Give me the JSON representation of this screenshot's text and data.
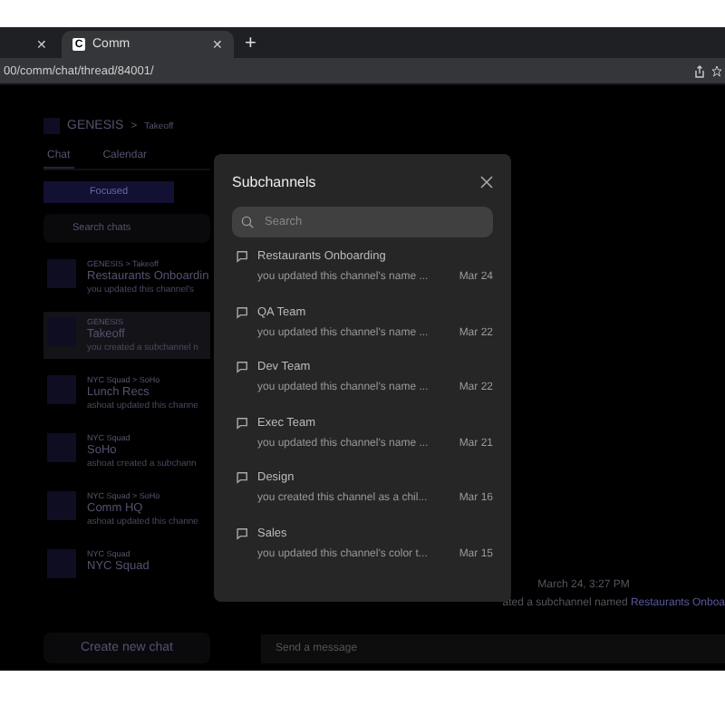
{
  "browser": {
    "tabs": [
      {
        "close": "✕",
        "selected": false
      },
      {
        "title": "Comm",
        "favicon": "C",
        "close": "✕",
        "selected": true
      }
    ],
    "new_tab": "+",
    "url": "00/comm/chat/thread/84001/"
  },
  "header": {
    "community": "GENESIS",
    "separator": ">",
    "channel": "Takeoff"
  },
  "sidebar": {
    "tabs": [
      {
        "label": "Chat",
        "selected": true
      },
      {
        "label": "Calendar",
        "selected": false
      }
    ],
    "filter": "Focused",
    "search_placeholder": "Search chats",
    "chats": [
      {
        "path": "GENESIS > Takeoff",
        "name": "Restaurants Onboardin",
        "preview": "you updated this channel's",
        "selected": false
      },
      {
        "path": "GENESIS",
        "name": "Takeoff",
        "preview": "you created a subchannel n",
        "selected": true
      },
      {
        "path": "NYC Squad > SoHo",
        "name": "Lunch Recs",
        "preview": "ashoat updated this channe",
        "selected": false
      },
      {
        "path": "NYC Squad",
        "name": "SoHo",
        "preview": "ashoat created a subchann",
        "selected": false
      },
      {
        "path": "NYC Squad > SoHo",
        "name": "Comm HQ",
        "preview": "ashoat updated this channe",
        "selected": false
      },
      {
        "path": "NYC Squad",
        "name": "NYC Squad",
        "selected": false
      }
    ],
    "create_button": "Create new chat"
  },
  "thread": {
    "timestamp": "March 24, 3:27 PM",
    "message": "ated a subchannel named ",
    "message_link": "Restaurants Onboa",
    "input_placeholder": "Send a message"
  },
  "modal": {
    "title": "Subchannels",
    "search_placeholder": "Search",
    "items": [
      {
        "name": "Restaurants Onboarding",
        "preview": "you updated this channel's name ...",
        "date": "Mar 24"
      },
      {
        "name": "QA Team",
        "preview": "you updated this channel's name ...",
        "date": "Mar 22"
      },
      {
        "name": "Dev Team",
        "preview": "you updated this channel's name ...",
        "date": "Mar 22"
      },
      {
        "name": "Exec Team",
        "preview": "you updated this channel's name ...",
        "date": "Mar 21"
      },
      {
        "name": "Design",
        "preview": "you created this channel as a chil...",
        "date": "Mar 16"
      },
      {
        "name": "Sales",
        "preview": "you updated this channel's color t...",
        "date": "Mar 15"
      }
    ]
  }
}
